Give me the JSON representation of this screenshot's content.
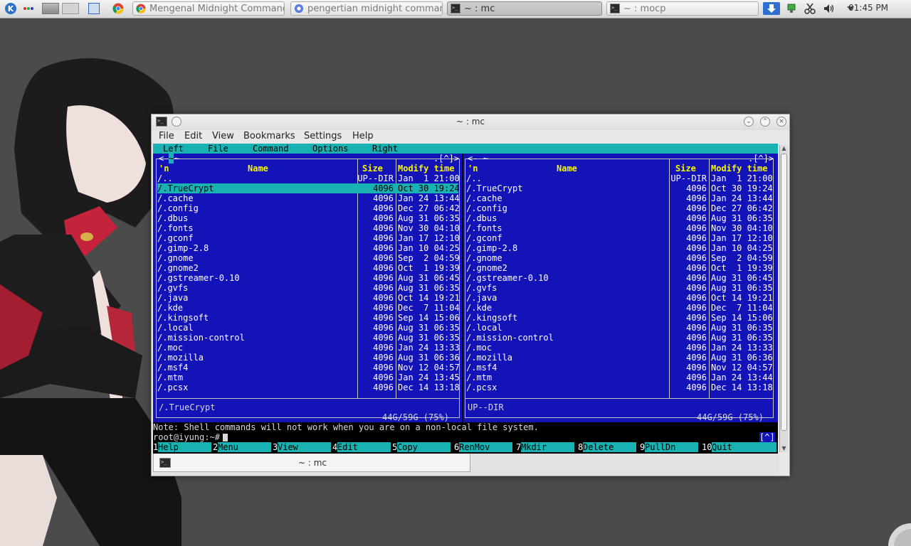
{
  "panel": {
    "tasks": [
      {
        "label": "Mengenal Midnight Command",
        "icon": "chrome-icon",
        "active": false
      },
      {
        "label": "pengertian midnight comman",
        "icon": "page-icon",
        "active": false
      },
      {
        "label": "~ : mc",
        "icon": "terminal-icon",
        "active": true
      },
      {
        "label": "~ : mocp",
        "icon": "terminal-icon",
        "active": false
      }
    ],
    "clock": "01:45 PM"
  },
  "window": {
    "title": "~ : mc",
    "menu": [
      "File",
      "Edit",
      "View",
      "Bookmarks",
      "Settings",
      "Help"
    ],
    "tab_label": "~ : mc"
  },
  "mc": {
    "menu": [
      "Left",
      "File",
      "Command",
      "Options",
      "Right"
    ],
    "left_top_left": "<- ~ ",
    "left_path_label": "~",
    "top_right_marker": ".[^]>",
    "right_top_left": "<- ~",
    "headers": {
      "sort": "'n",
      "name": "Name",
      "size": "Size",
      "mtime": "Modify time"
    },
    "files": [
      {
        "name": "/..",
        "size": "UP--DIR",
        "mtime": "Jan  1 21:00"
      },
      {
        "name": "/.TrueCrypt",
        "size": "4096",
        "mtime": "Oct 30 19:24"
      },
      {
        "name": "/.cache",
        "size": "4096",
        "mtime": "Jan 24 13:44"
      },
      {
        "name": "/.config",
        "size": "4096",
        "mtime": "Dec 27 06:42"
      },
      {
        "name": "/.dbus",
        "size": "4096",
        "mtime": "Aug 31 06:35"
      },
      {
        "name": "/.fonts",
        "size": "4096",
        "mtime": "Nov 30 04:10"
      },
      {
        "name": "/.gconf",
        "size": "4096",
        "mtime": "Jan 17 12:10"
      },
      {
        "name": "/.gimp-2.8",
        "size": "4096",
        "mtime": "Jan 10 04:25"
      },
      {
        "name": "/.gnome",
        "size": "4096",
        "mtime": "Sep  2 04:59"
      },
      {
        "name": "/.gnome2",
        "size": "4096",
        "mtime": "Oct  1 19:39"
      },
      {
        "name": "/.gstreamer-0.10",
        "size": "4096",
        "mtime": "Aug 31 06:45"
      },
      {
        "name": "/.gvfs",
        "size": "4096",
        "mtime": "Aug 31 06:35"
      },
      {
        "name": "/.java",
        "size": "4096",
        "mtime": "Oct 14 19:21"
      },
      {
        "name": "/.kde",
        "size": "4096",
        "mtime": "Dec  7 11:04"
      },
      {
        "name": "/.kingsoft",
        "size": "4096",
        "mtime": "Sep 14 15:06"
      },
      {
        "name": "/.local",
        "size": "4096",
        "mtime": "Aug 31 06:35"
      },
      {
        "name": "/.mission-control",
        "size": "4096",
        "mtime": "Aug 31 06:35"
      },
      {
        "name": "/.moc",
        "size": "4096",
        "mtime": "Jan 24 13:33"
      },
      {
        "name": "/.mozilla",
        "size": "4096",
        "mtime": "Aug 31 06:36"
      },
      {
        "name": "/.msf4",
        "size": "4096",
        "mtime": "Nov 12 04:57"
      },
      {
        "name": "/.mtm",
        "size": "4096",
        "mtime": "Jan 24 13:45"
      },
      {
        "name": "/.pcsx",
        "size": "4096",
        "mtime": "Dec 14 13:18"
      }
    ],
    "right_files": [
      {
        "name": "/..",
        "size": "UP--DIR",
        "mtime": "Jan  1 21:00"
      },
      {
        "name": "/.TrueCrypt",
        "size": "4096",
        "mtime": "Oct 30 19:24"
      },
      {
        "name": "/.cache",
        "size": "4096",
        "mtime": "Jan 24 13:44"
      },
      {
        "name": "/.config",
        "size": "4096",
        "mtime": "Dec 27 06:42"
      },
      {
        "name": "/.dbus",
        "size": "4096",
        "mtime": "Aug 31 06:35"
      },
      {
        "name": "/.fonts",
        "size": "4096",
        "mtime": "Nov 30 04:10"
      },
      {
        "name": "/.gconf",
        "size": "4096",
        "mtime": "Jan 17 12:10"
      },
      {
        "name": "/.gimp-2.8",
        "size": "4096",
        "mtime": "Jan 10 04:25"
      },
      {
        "name": "/.gnome",
        "size": "4096",
        "mtime": "Sep  2 04:59"
      },
      {
        "name": "/.gnome2",
        "size": "4096",
        "mtime": "Oct  1 19:39"
      },
      {
        "name": "/.gstreamer-0.10",
        "size": "4096",
        "mtime": "Aug 31 06:45"
      },
      {
        "name": "/.gvfs",
        "size": "4096",
        "mtime": "Aug 31 06:35"
      },
      {
        "name": "/.java",
        "size": "4096",
        "mtime": "Oct 14 19:21"
      },
      {
        "name": "/.kde",
        "size": "4096",
        "mtime": "Dec  7 11:04"
      },
      {
        "name": "/.kingsoft",
        "size": "4096",
        "mtime": "Sep 14 15:06"
      },
      {
        "name": "/.local",
        "size": "4096",
        "mtime": "Aug 31 06:35"
      },
      {
        "name": "/.mission-control",
        "size": "4096",
        "mtime": "Aug 31 06:35"
      },
      {
        "name": "/.moc",
        "size": "4096",
        "mtime": "Jan 24 13:33"
      },
      {
        "name": "/.mozilla",
        "size": "4096",
        "mtime": "Aug 31 06:36"
      },
      {
        "name": "/.msf4",
        "size": "4096",
        "mtime": "Nov 12 04:57"
      },
      {
        "name": "/.mtm",
        "size": "4096",
        "mtime": "Jan 24 13:44"
      },
      {
        "name": "/.pcsx",
        "size": "4096",
        "mtime": "Dec 14 13:18"
      }
    ],
    "left_status": "/.TrueCrypt",
    "right_status": "UP--DIR",
    "disk": "44G/59G (75%)",
    "note": "Note: Shell commands will not work when you are on a non-local file system.",
    "prompt": "root@iyung:~#",
    "prompt_marker": "[^]",
    "fkeys": [
      {
        "num": "1",
        "label": "Help"
      },
      {
        "num": "2",
        "label": "Menu"
      },
      {
        "num": "3",
        "label": "View"
      },
      {
        "num": "4",
        "label": "Edit"
      },
      {
        "num": "5",
        "label": "Copy"
      },
      {
        "num": "6",
        "label": "RenMov"
      },
      {
        "num": "7",
        "label": "Mkdir"
      },
      {
        "num": "8",
        "label": "Delete"
      },
      {
        "num": "9",
        "label": "PullDn"
      },
      {
        "num": "10",
        "label": "Quit"
      }
    ]
  },
  "colors": {
    "pane_bg": "#1313b8",
    "bar_cyan": "#18b2b2",
    "header_yellow": "#f6f600"
  }
}
